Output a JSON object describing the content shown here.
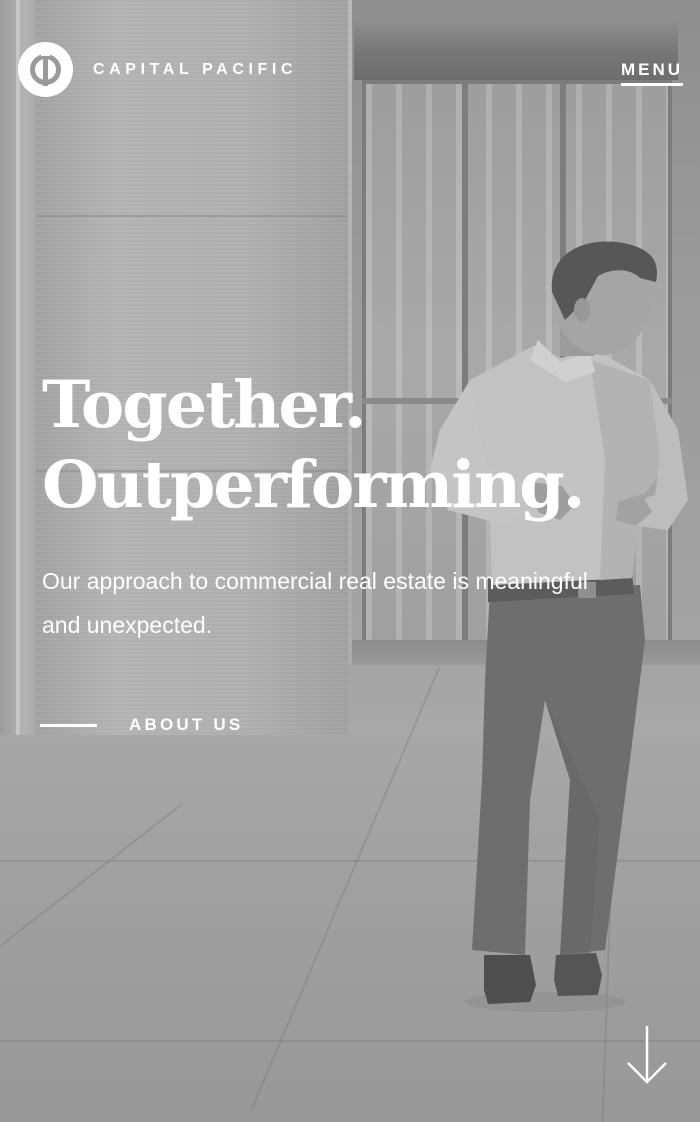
{
  "header": {
    "logo_text": "CAPITAL PACIFIC",
    "logo_icon": "capital-pacific-logo-icon",
    "menu_label": "MENU"
  },
  "hero": {
    "title_line_1": "Together.",
    "title_line_2": "Outperforming.",
    "subtitle": "Our approach to commercial real estate is meaningful and unexpected.",
    "cta_label": "ABOUT US"
  },
  "scroll": {
    "icon": "arrow-down-icon"
  },
  "colors": {
    "text": "#ffffff",
    "overlay": "#a0a0a0"
  }
}
